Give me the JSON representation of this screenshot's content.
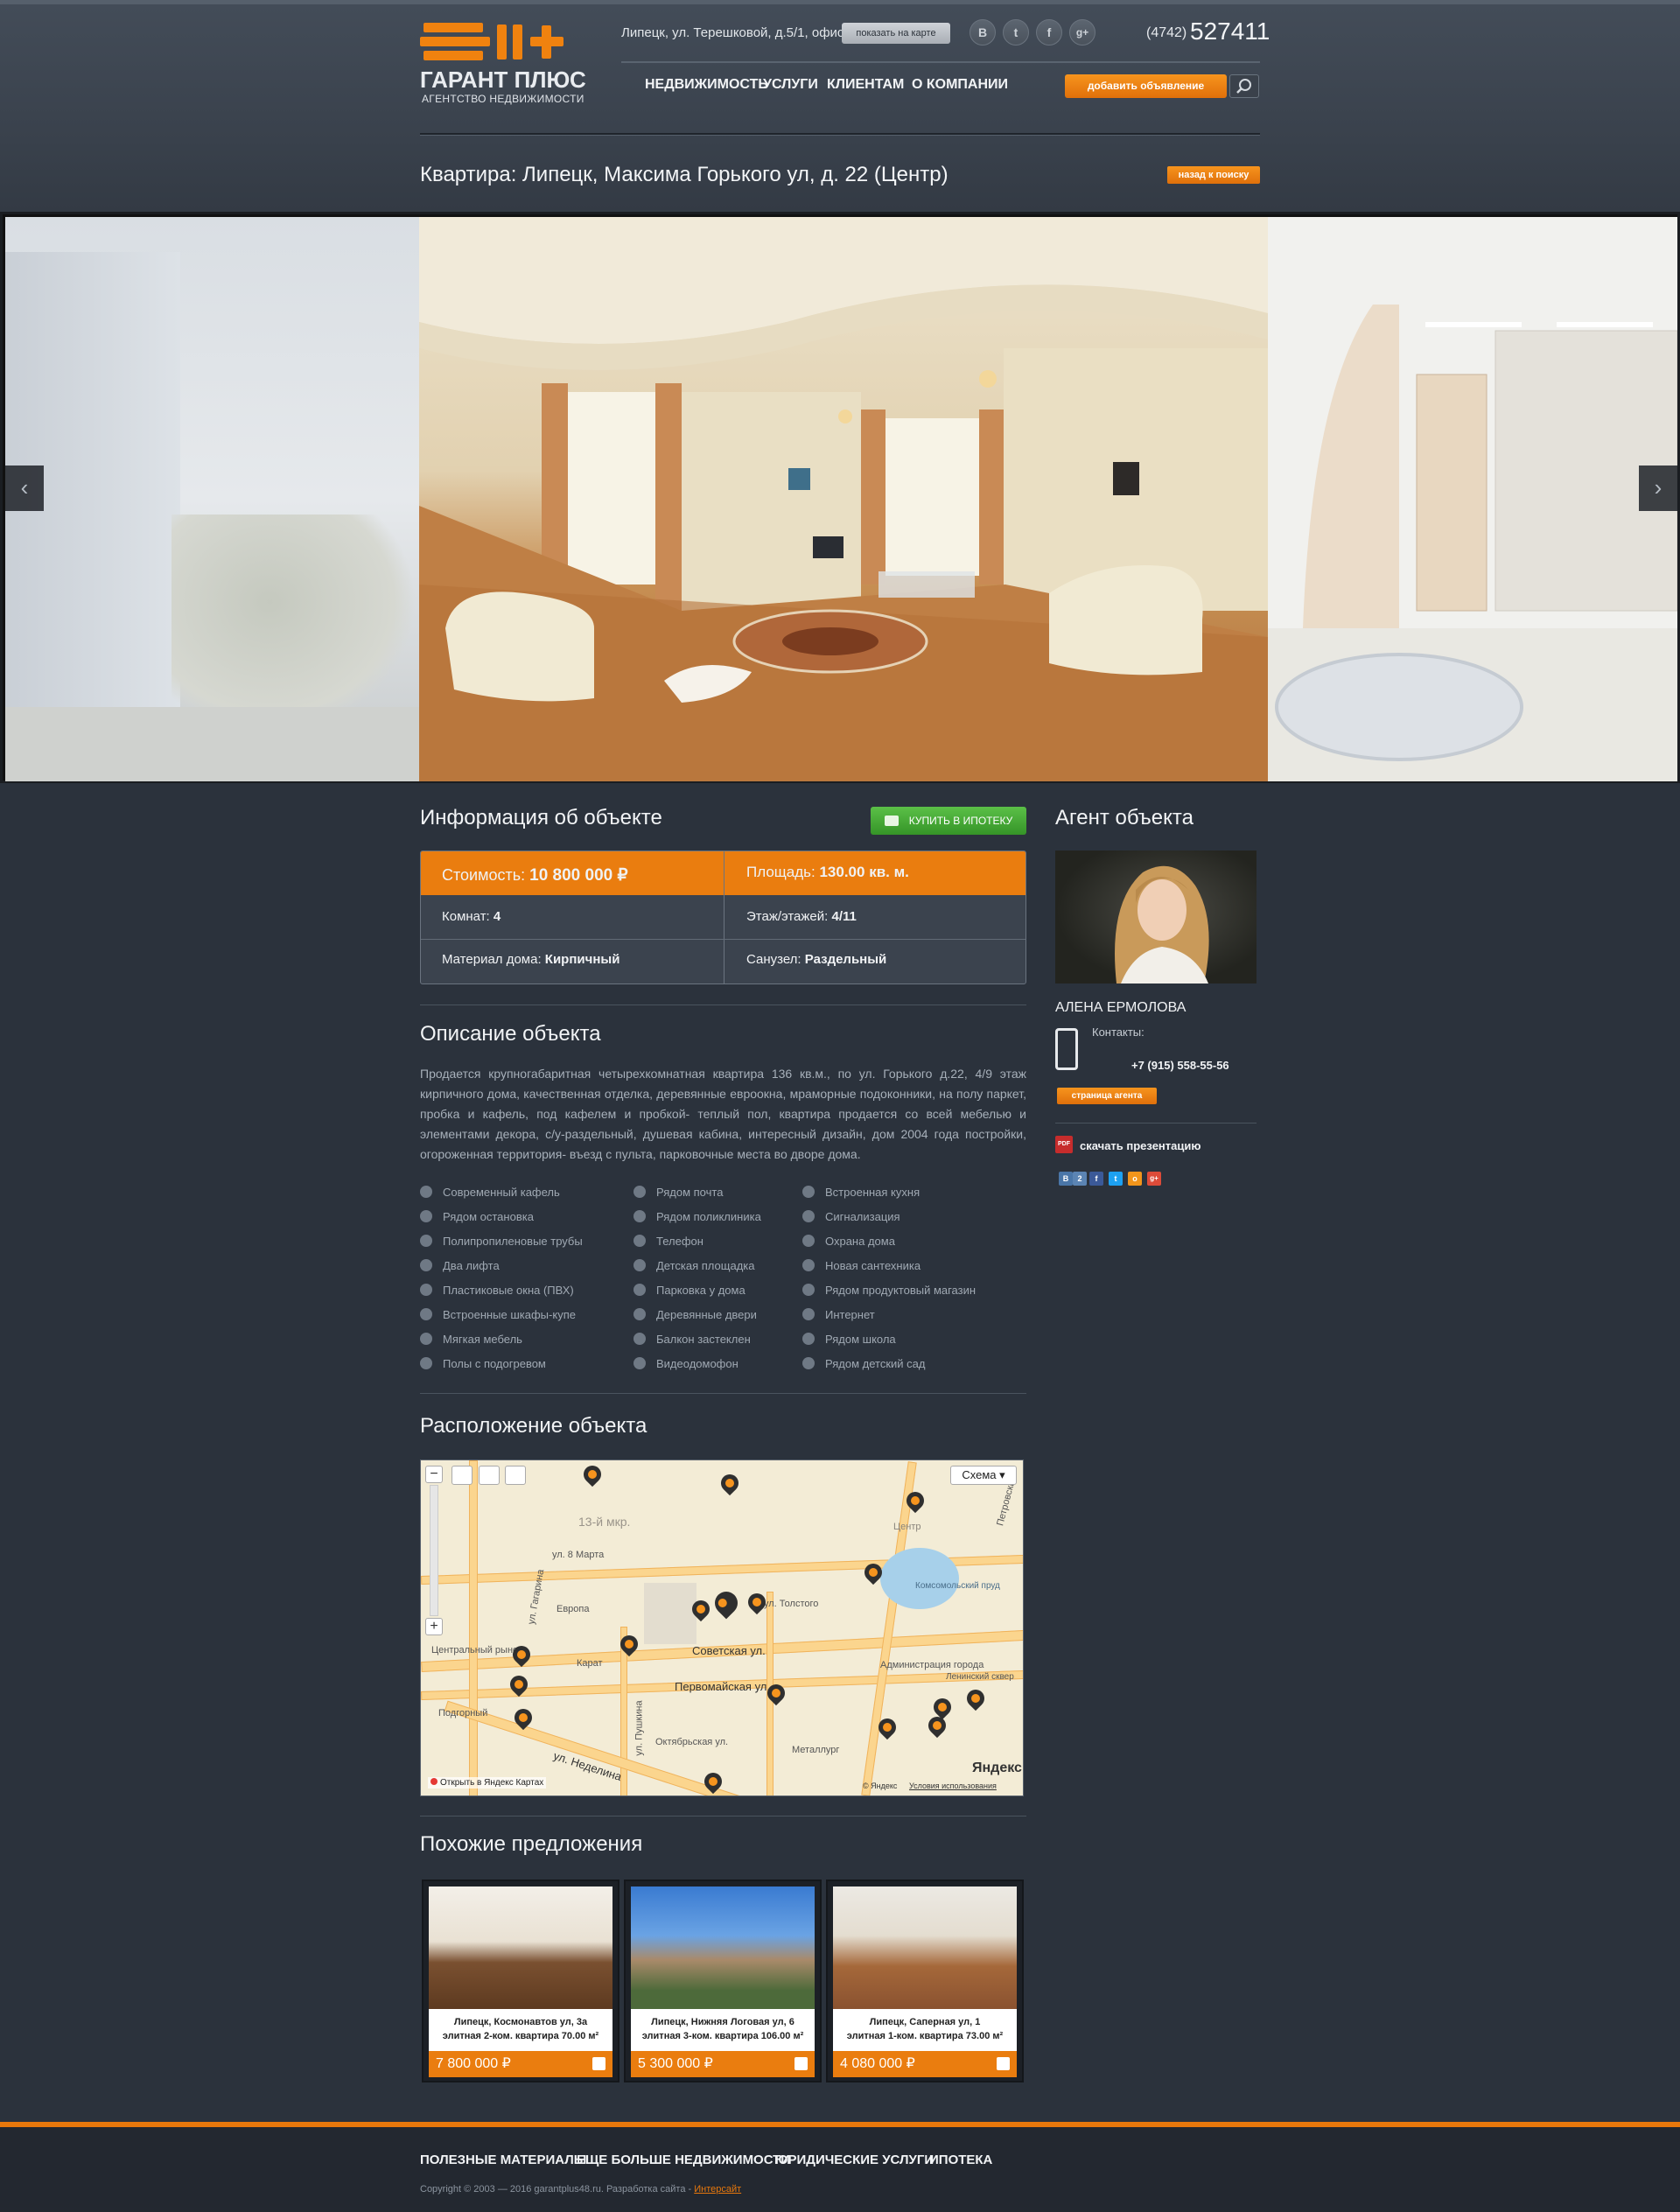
{
  "header": {
    "logo": {
      "title": "ГАРАНТ ПЛЮС",
      "subtitle": "АГЕНТСТВО НЕДВИЖИМОСТИ"
    },
    "address": "Липецк, ул. Терешковой, д.5/1, офис 3",
    "map_button": "показать на карте",
    "socials": [
      {
        "icon": "vk-icon",
        "glyph": "В"
      },
      {
        "icon": "twitter-icon",
        "glyph": "t"
      },
      {
        "icon": "facebook-icon",
        "glyph": "f"
      },
      {
        "icon": "google-plus-icon",
        "glyph": "g+"
      }
    ],
    "phone_code": "(4742)",
    "phone_number": "527411",
    "nav": [
      "НЕДВИЖИМОСТЬ",
      "УСЛУГИ",
      "КЛИЕНТАМ",
      "О КОМПАНИИ"
    ],
    "add_button": "добавить объявление",
    "search_icon": "search-icon"
  },
  "page": {
    "title": "Квартира: Липецк, Максима Горького ул, д. 22 (Центр)",
    "back_button": "назад к поиску"
  },
  "gallery": {
    "prev_icon": "chevron-left-icon",
    "next_icon": "chevron-right-icon",
    "prev_glyph": "‹",
    "next_glyph": "›"
  },
  "info": {
    "heading": "Информация об объекте",
    "ipoteka_button": "КУПИТЬ В ИПОТЕКУ",
    "cost_label": "Стоимость:",
    "cost_value": "10 800 000 ₽",
    "area_label": "Площадь:",
    "area_value": "130.00 кв. м.",
    "rooms_label": "Комнат:",
    "rooms_value": "4",
    "floor_label": "Этаж/этажей:",
    "floor_value": "4/11",
    "material_label": "Материал дома:",
    "material_value": "Кирпичный",
    "bathroom_label": "Санузел:",
    "bathroom_value": "Раздельный"
  },
  "description": {
    "heading": "Описание объекта",
    "text": "Продается крупногабаритная четырехкомнатная квартира 136 кв.м., по ул. Горького д.22, 4/9 этаж кирпичного дома, качественная отделка, деревянные евроокна, мраморные подоконники, на полу паркет, пробка и кафель, под кафелем и пробкой- теплый пол, квартира продается со всей мебелью и элементами декора, с/у-раздельный, душевая кабина, интересный дизайн, дом 2004 года постройки, огороженная территория- въезд с пульта, парковочные места во дворе дома.",
    "features_col1": [
      "Современный кафель",
      "Рядом остановка",
      "Полипропиленовые трубы",
      "Два лифта",
      "Пластиковые окна (ПВХ)",
      "Встроенные шкафы-купе",
      "Мягкая мебель",
      "Полы с подогревом"
    ],
    "features_col2": [
      "Рядом почта",
      "Рядом поликлиника",
      "Телефон",
      "Детская площадка",
      "Парковка у дома",
      "Деревянные двери",
      "Балкон застеклен",
      "Видеодомофон"
    ],
    "features_col3": [
      "Встроенная кухня",
      "Сигнализация",
      "Охрана дома",
      "Новая сантехника",
      "Рядом продуктовый магазин",
      "Интернет",
      "Рядом школа",
      "Рядом детский сад"
    ]
  },
  "location": {
    "heading": "Расположение объекта",
    "map_type": "Схема ▾",
    "open_in_yandex": "Открыть в Яндекс Картах",
    "yandex_logo": "Яндекс",
    "copyright": "© Яндекс",
    "terms": "Условия использования",
    "labels": [
      "13-й мкр.",
      "ул. 8 Марта",
      "Европа",
      "Советская ул.",
      "Первомайская ул.",
      "Центральный рынок",
      "Карат",
      "Администрация города",
      "Октябрьская ул.",
      "Металлург",
      "ул. Неделина",
      "Подгорный",
      "Центр",
      "Комсомольский пруд",
      "Ленинский сквер",
      "ул. Толстого",
      "ул. Пушкина",
      "ул. Гагарина",
      "Петровский"
    ]
  },
  "similar": {
    "heading": "Похожие предложения",
    "items": [
      {
        "line1": "Липецк, Космонавтов ул, 3а",
        "line2": "элитная 2-ком. квартира 70.00 м²",
        "price": "7 800 000 ₽"
      },
      {
        "line1": "Липецк, Нижняя Логовая ул, 6",
        "line2": "элитная 3-ком. квартира 106.00 м²",
        "price": "5 300 000 ₽"
      },
      {
        "line1": "Липецк, Саперная ул, 1",
        "line2": "элитная 1-ком. квартира 73.00 м²",
        "price": "4 080 000 ₽"
      }
    ]
  },
  "agent": {
    "heading": "Агент объекта",
    "name": "АЛЕНА ЕРМОЛОВА",
    "contacts_label": "Контакты:",
    "phone": "+7 (915) 558-55-56",
    "page_button": "страница агента",
    "pdf_badge": "PDF",
    "download": "скачать презентацию",
    "share": [
      {
        "icon": "vk-share-icon",
        "glyph": "В",
        "color": "#4a76a8"
      },
      {
        "icon": "share-count-icon",
        "glyph": "2",
        "color": "#4a76a8"
      },
      {
        "icon": "facebook-share-icon",
        "glyph": "f",
        "color": "#3b5998"
      },
      {
        "icon": "twitter-share-icon",
        "glyph": "t",
        "color": "#1da1f2"
      },
      {
        "icon": "odnoklassniki-share-icon",
        "glyph": "o",
        "color": "#f2951b"
      },
      {
        "icon": "google-plus-share-icon",
        "glyph": "g+",
        "color": "#dd4b39"
      }
    ]
  },
  "footer": {
    "nav": [
      "ПОЛЕЗНЫЕ МАТЕРИАЛЫ",
      "ЕЩЕ БОЛЬШЕ НЕДВИЖИМОСТИ",
      "ЮРИДИЧЕСКИЕ УСЛУГИ",
      "ИПОТЕКА"
    ],
    "copyright": "Copyright © 2003 — 2016 garantplus48.ru.   Разработка сайта - ",
    "dev_link": "Интерсайт"
  },
  "colors": {
    "accent": "#ea7d0f",
    "background": "#2b323c",
    "green": "#4cae3a"
  }
}
